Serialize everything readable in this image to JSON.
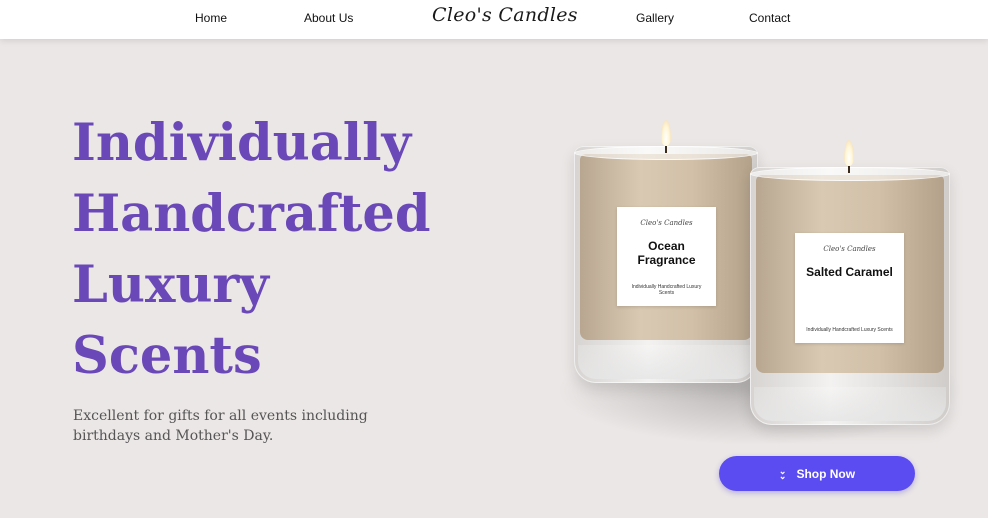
{
  "nav": {
    "home": "Home",
    "about": "About Us",
    "logo": "Cleo's Candles",
    "gallery": "Gallery",
    "contact": "Contact"
  },
  "hero": {
    "headline_lines": [
      "Individually",
      "Handcrafted",
      "Luxury",
      "Scents"
    ],
    "subtext": "Excellent for gifts for all events including birthdays and Mother's Day.",
    "cta_label": "Shop Now",
    "cta_icon": "double-chevron-down-icon"
  },
  "products": [
    {
      "brand": "Cleo's Candles",
      "scent": "Ocean Fragrance",
      "tagline": "Individually Handcrafted Luxury Scents"
    },
    {
      "brand": "Cleo's Candles",
      "scent": "Salted Caramel",
      "tagline": "Individually Handcrafted Luxury Scents"
    }
  ],
  "colors": {
    "background": "#ebe7e6",
    "headline": "#6a48b8",
    "cta": "#5a4cf0"
  }
}
